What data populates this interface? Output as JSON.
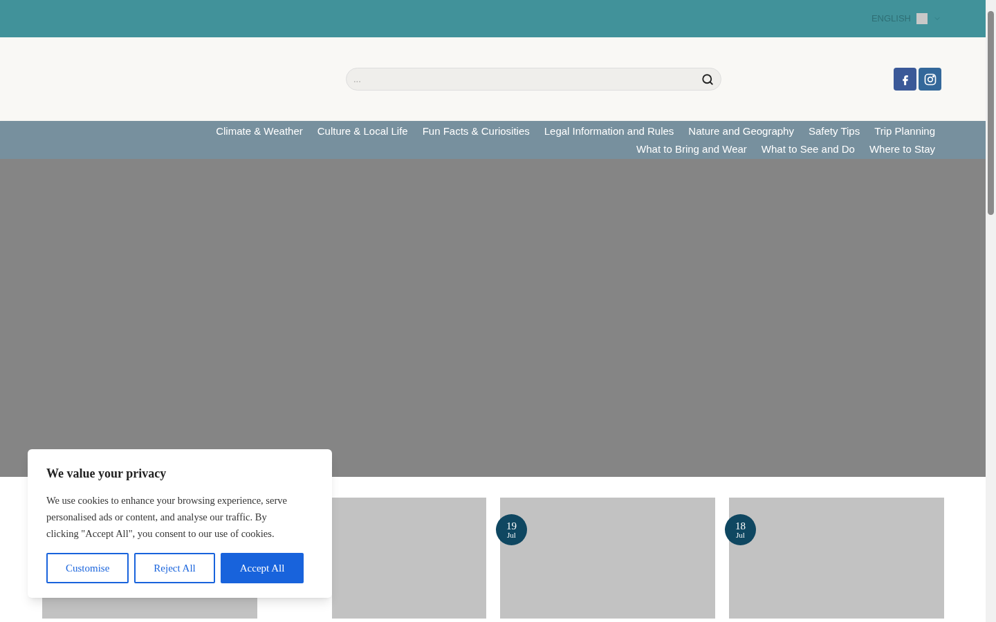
{
  "top_bar": {
    "language": "ENGLISH"
  },
  "header": {
    "search": {
      "placeholder": "..."
    }
  },
  "nav": {
    "items": [
      "Climate & Weather",
      "Culture & Local Life",
      "Fun Facts & Curiosities",
      "Legal Information and Rules",
      "Nature and Geography",
      "Safety Tips",
      "Trip Planning",
      "What to Bring and Wear",
      "What to See and Do",
      "Where to Stay"
    ]
  },
  "posts": [
    {
      "kind": "plain"
    },
    {
      "kind": "plain"
    },
    {
      "kind": "dated",
      "day": "19",
      "month": "Jul"
    },
    {
      "kind": "dated",
      "day": "18",
      "month": "Jul"
    }
  ],
  "cookie_banner": {
    "title": "We value your privacy",
    "text": "We use cookies to enhance your browsing experience, serve personalised ads or content, and analyse our traffic. By clicking \"Accept All\", you consent to our use of cookies.",
    "buttons": [
      {
        "label": "Customise",
        "kind": "outline"
      },
      {
        "label": "Reject All",
        "kind": "outline"
      },
      {
        "label": "Accept All",
        "kind": "primary"
      }
    ]
  }
}
